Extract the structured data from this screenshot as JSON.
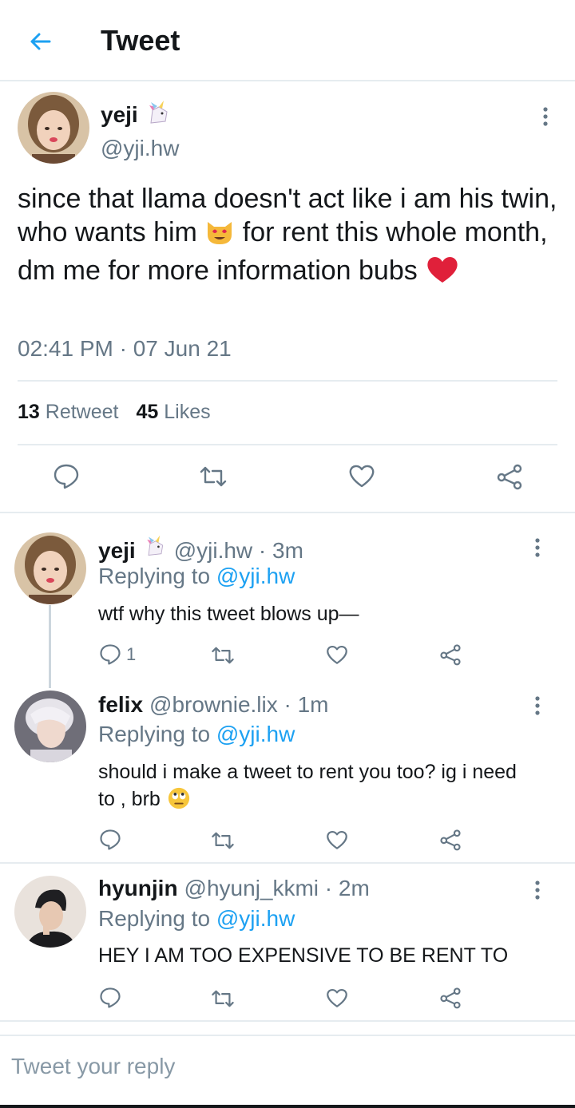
{
  "header": {
    "title": "Tweet"
  },
  "tweet": {
    "name": "yeji",
    "handle": "@yji.hw",
    "text_1": "since that llama doesn't act like i am his twin, who wants him ",
    "text_2": " for rent this whole month, dm me for more information bubs ",
    "timestamp": "02:41 PM · 07 Jun 21",
    "retweets": "13",
    "retweets_label": "Retweet",
    "likes": "45",
    "likes_label": "Likes"
  },
  "replies": [
    {
      "name": "yeji",
      "handle_time": "@yji.hw · 3m",
      "replying_prefix": "Replying to",
      "replying_to": "@yji.hw",
      "text": "wtf why this tweet blows up—",
      "reply_count": "1"
    },
    {
      "name": "felix",
      "handle_time": "@brownie.lix · 1m",
      "replying_prefix": "Replying to",
      "replying_to": "@yji.hw",
      "text": "should i make a tweet to rent you too? ig i need to , brb "
    },
    {
      "name": "hyunjin",
      "handle_time": "@hyunj_kkmi · 2m",
      "replying_prefix": "Replying to",
      "replying_to": "@yji.hw",
      "text": "HEY I AM TOO EXPENSIVE TO BE RENT TO"
    }
  ],
  "reply_box": {
    "placeholder": "Tweet your reply"
  },
  "icons": {
    "back": "arrow-left-icon",
    "more": "more-vertical-icon",
    "reply": "comment-icon",
    "retweet": "retweet-icon",
    "like": "heart-icon",
    "share": "share-icon"
  },
  "colors": {
    "accent": "#1da1f2",
    "secondary_text": "#657786",
    "divider": "#e6ecf0"
  }
}
